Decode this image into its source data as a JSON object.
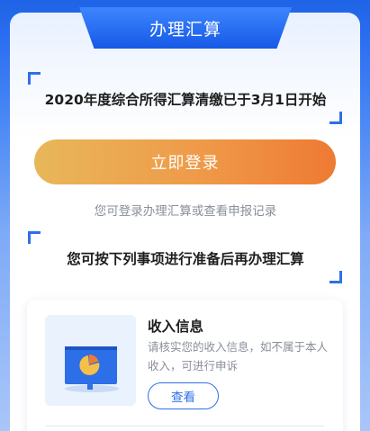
{
  "banner": {
    "title": "办理汇算"
  },
  "announcement": {
    "text": "2020年度综合所得汇算清缴已于3月1日开始"
  },
  "login": {
    "button_label": "立即登录"
  },
  "secondary": {
    "link_text": "您可登录办理汇算或查看申报记录"
  },
  "prep": {
    "heading": "您可按下列事项进行准备后再办理汇算"
  },
  "items": [
    {
      "title": "收入信息",
      "description": "请核实您的收入信息，如不属于本人收入，可进行申诉",
      "button_label": "查看",
      "icon": "presentation-pie-chart-icon"
    }
  ],
  "colors": {
    "accent": "#2f6fe9",
    "button_gradient_start": "#e8b75a",
    "button_gradient_end": "#ee7a33",
    "background": "#2a6df0"
  }
}
